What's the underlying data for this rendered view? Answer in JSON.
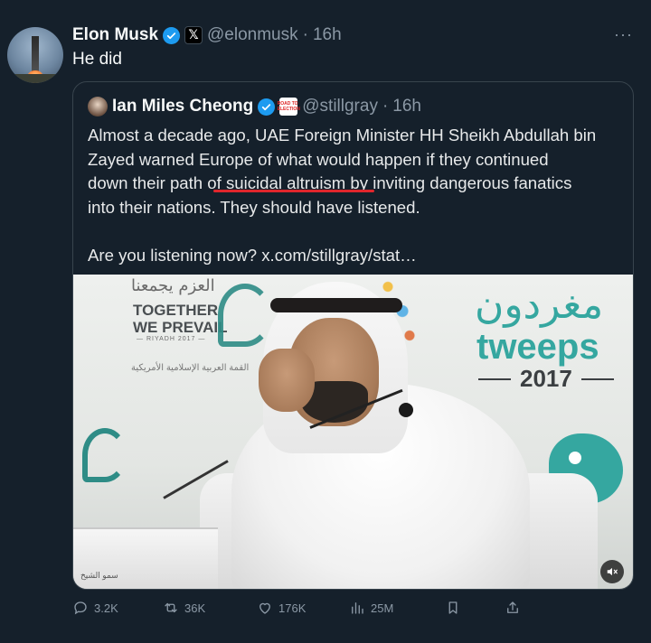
{
  "post": {
    "author_name": "Elon Musk",
    "handle": "@elonmusk",
    "separator": "·",
    "time": "16h",
    "more": "···",
    "text": "He did"
  },
  "quote": {
    "author_name": "Ian Miles Cheong",
    "handle": "@stillgray",
    "separator": "·",
    "time": "16h",
    "badge_text": "ROAD TO ELECTION",
    "paragraph1_lines": [
      "Almost a decade ago, UAE Foreign Minister HH Sheikh Abdullah bin",
      "Zayed warned Europe of what would happen if they continued",
      "down their path of suicidal altruism by inviting dangerous fanatics",
      "into their nations. They should have listened."
    ],
    "paragraph2": "Are you listening now? x.com/stillgray/stat…",
    "video": {
      "together_line1": "TOGETHER",
      "together_line2": "WE PREVAIL",
      "riyadh": "— RIYADH 2017 —",
      "arabic_top": "العزم يجمعنا",
      "arabic_mid": "القمة العربية الإسلامية الأمريكية",
      "arabic_right": "مغردون",
      "tweeps": "tweeps",
      "year": "2017",
      "table_text": "سمو الشيخ"
    }
  },
  "actions": {
    "replies": "3.2K",
    "reposts": "36K",
    "likes": "176K",
    "views": "25M"
  },
  "colors": {
    "background": "#15202b",
    "verified": "#1d9bf0",
    "muted": "#8b98a5",
    "underline": "#e0262c"
  }
}
